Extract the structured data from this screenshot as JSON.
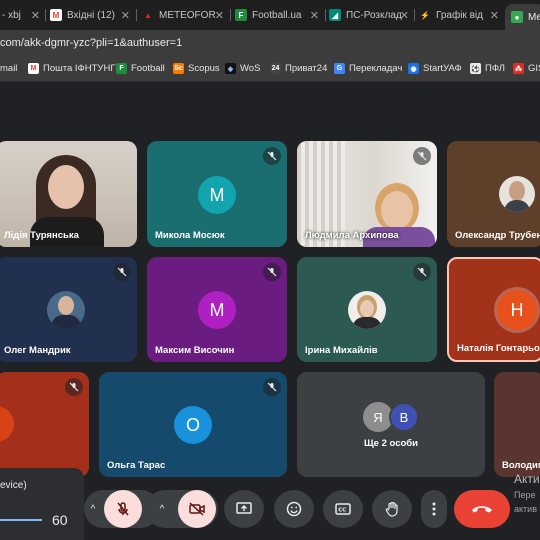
{
  "browser": {
    "tabs": [
      {
        "label": "- xbj",
        "color": "#5f6368",
        "glyph": ""
      },
      {
        "label": "Вхідні (12)",
        "color": "#ea4335",
        "glyph": "M"
      },
      {
        "label": "METEOFOR",
        "color": "#d93025",
        "glyph": "▲"
      },
      {
        "label": "Football.ua",
        "color": "#1e8e3e",
        "glyph": "F"
      },
      {
        "label": "ПС-Розклад",
        "color": "#00897b",
        "glyph": "◢"
      },
      {
        "label": "Графік від",
        "color": "#f9ab00",
        "glyph": "⚡"
      },
      {
        "label": "Me",
        "color": "#34a853",
        "glyph": "●"
      }
    ],
    "url": "com/akk-dgmr-yzc?pli=1&authuser=1",
    "bookmarks": [
      {
        "label": "mail",
        "color": "#3c3c3c",
        "glyph": ""
      },
      {
        "label": "Пошта ІФНТУНГ",
        "color": "#ea4335",
        "glyph": "M"
      },
      {
        "label": "Football",
        "color": "#1e8e3e",
        "glyph": "F"
      },
      {
        "label": "Scopus",
        "color": "#f57c00",
        "glyph": "Sc"
      },
      {
        "label": "WoS",
        "color": "#202124",
        "glyph": "◆"
      },
      {
        "label": "Приват24",
        "color": "#444",
        "glyph": "24"
      },
      {
        "label": "Перекладач",
        "color": "#4285f4",
        "glyph": "G"
      },
      {
        "label": "StartУАФ",
        "color": "#1a73e8",
        "glyph": "◉"
      },
      {
        "label": "ПФЛ",
        "color": "#e8eaed",
        "glyph": "⚽"
      },
      {
        "label": "GIS",
        "color": "#d93025",
        "glyph": "⁂"
      }
    ]
  },
  "participants": [
    {
      "name": "Лідія Турянська",
      "kind": "video",
      "muted": false
    },
    {
      "name": "Микола Мосюк",
      "kind": "avatar",
      "initial": "M",
      "color": "#12a4af",
      "tile_color": "#1b6e6f",
      "muted": true
    },
    {
      "name": "Людмила Архипова",
      "kind": "video",
      "muted": true
    },
    {
      "name": "Олександр Трубенок",
      "kind": "photo",
      "tile_color": "#5d3f2a",
      "muted": false
    },
    {
      "name": "Олег Мандрик",
      "kind": "photo",
      "tile_color": "#21304e",
      "muted": true
    },
    {
      "name": "Максим Височин",
      "kind": "avatar",
      "initial": "M",
      "color": "#b01fc1",
      "tile_color": "#6a1c80",
      "muted": true
    },
    {
      "name": "Ірина Михайлів",
      "kind": "photo",
      "tile_color": "#2c5a52",
      "muted": true
    },
    {
      "name": "Наталія Гонтарьова",
      "kind": "avatar",
      "initial": "H",
      "color": "#e8501c",
      "tile_color": "#a3321a",
      "muted": false,
      "speaking": true
    },
    {
      "name": "",
      "kind": "partial",
      "tile_color": "#a4301c",
      "muted": true
    },
    {
      "name": "Ольга Тарас",
      "kind": "avatar",
      "initial": "O",
      "color": "#1a91db",
      "tile_color": "#164a6c",
      "muted": true
    },
    {
      "name": "Ще 2 особи",
      "kind": "group",
      "tile_color": "#3c4043",
      "initials": [
        "Я",
        "В"
      ]
    },
    {
      "name": "Володим",
      "kind": "partial",
      "tile_color": "#5a3530",
      "muted": false
    }
  ],
  "audio_popup": {
    "device_label": "evice)",
    "volume": "60"
  },
  "watermark": {
    "line1": "Акти",
    "line2": "Пере",
    "line3": "актив"
  },
  "controls": [
    {
      "name": "mic",
      "state": "off"
    },
    {
      "name": "camera",
      "state": "off"
    },
    {
      "name": "present",
      "state": "normal"
    },
    {
      "name": "emoji",
      "state": "normal"
    },
    {
      "name": "captions",
      "state": "normal"
    },
    {
      "name": "raise-hand",
      "state": "normal"
    },
    {
      "name": "more",
      "state": "normal"
    },
    {
      "name": "leave-call",
      "state": "danger"
    }
  ],
  "colors": {
    "background": "#202124",
    "control": "#3c4043",
    "off_button": "#f9dedc",
    "leave": "#ea4335",
    "speaking_border": "#f7c8b4"
  }
}
